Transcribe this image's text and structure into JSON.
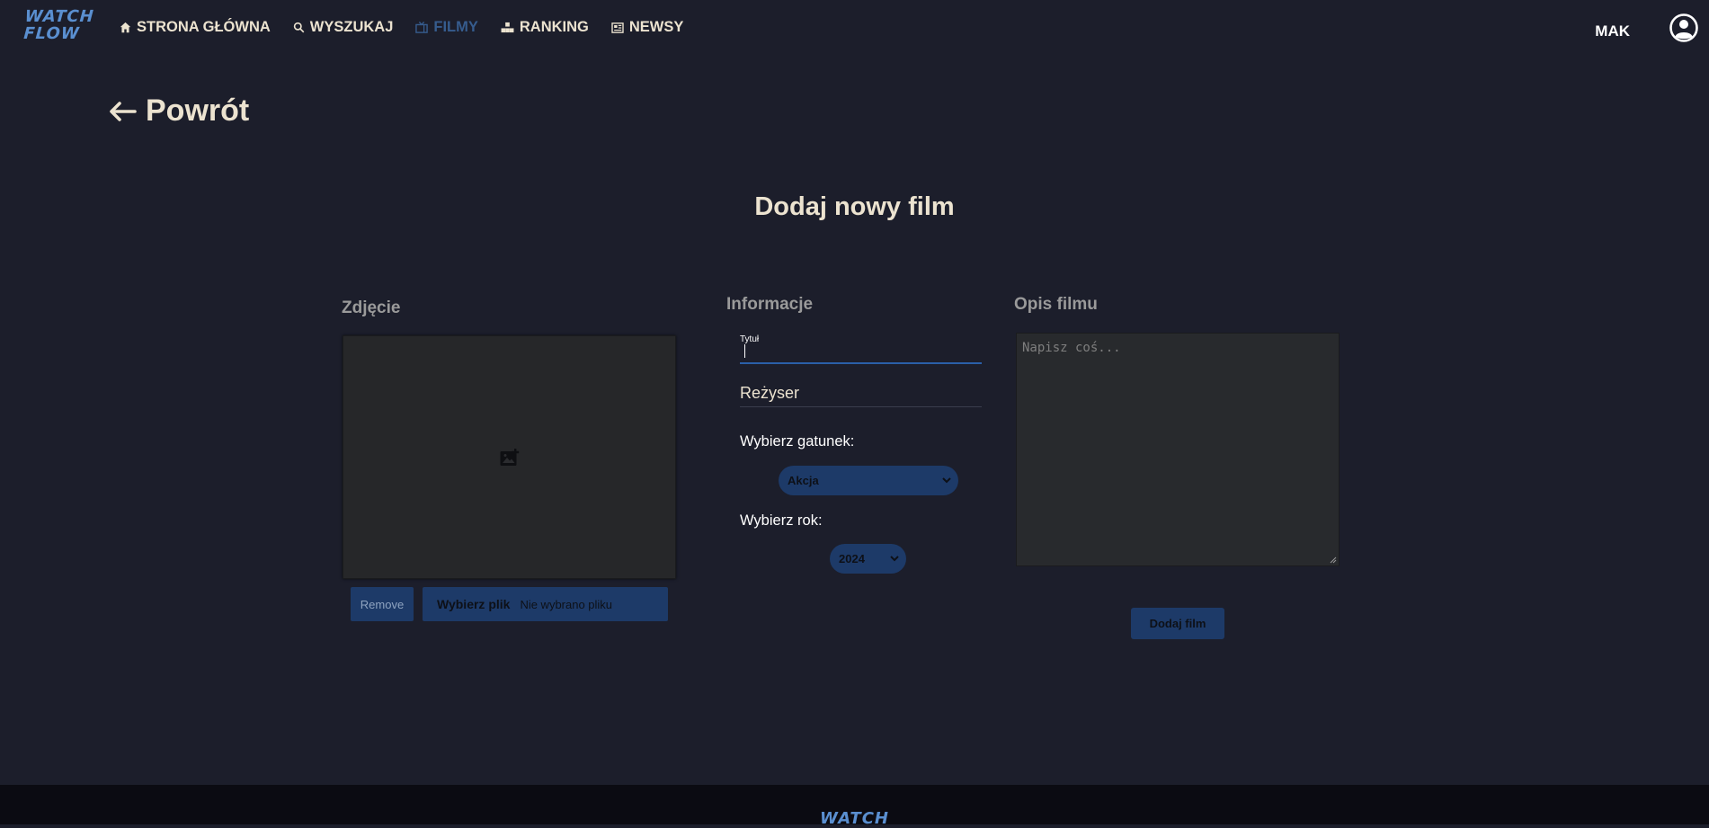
{
  "app": {
    "logo_line1": "WATCH",
    "logo_line2": "FLOW",
    "accent_color": "#365c8e"
  },
  "nav": {
    "items": [
      {
        "label": "STRONA GŁÓWNA",
        "icon": "home-icon"
      },
      {
        "label": "WYSZUKAJ",
        "icon": "search-icon"
      },
      {
        "label": "FILMY",
        "icon": "film-icon",
        "active": true
      },
      {
        "label": "RANKING",
        "icon": "ranking-icon"
      },
      {
        "label": "NEWSY",
        "icon": "news-icon"
      }
    ],
    "user_name": "MAK"
  },
  "back": {
    "label": "Powrót"
  },
  "page": {
    "title": "Dodaj nowy film"
  },
  "photo": {
    "section_label": "Zdjęcie",
    "remove_label": "Remove",
    "file_button_label": "Wybierz plik",
    "file_status": "Nie wybrano pliku"
  },
  "info": {
    "section_label": "Informacje",
    "title_field_label": "Tytuł",
    "title_value": "",
    "director_placeholder": "Reżyser",
    "genre_label": "Wybierz gatunek:",
    "genre_value": "Akcja",
    "year_label": "Wybierz rok:",
    "year_value": "2024"
  },
  "description": {
    "section_label": "Opis filmu",
    "placeholder": "Napisz coś..."
  },
  "submit": {
    "label": "Dodaj film"
  },
  "footer": {
    "logo": "WATCH"
  }
}
